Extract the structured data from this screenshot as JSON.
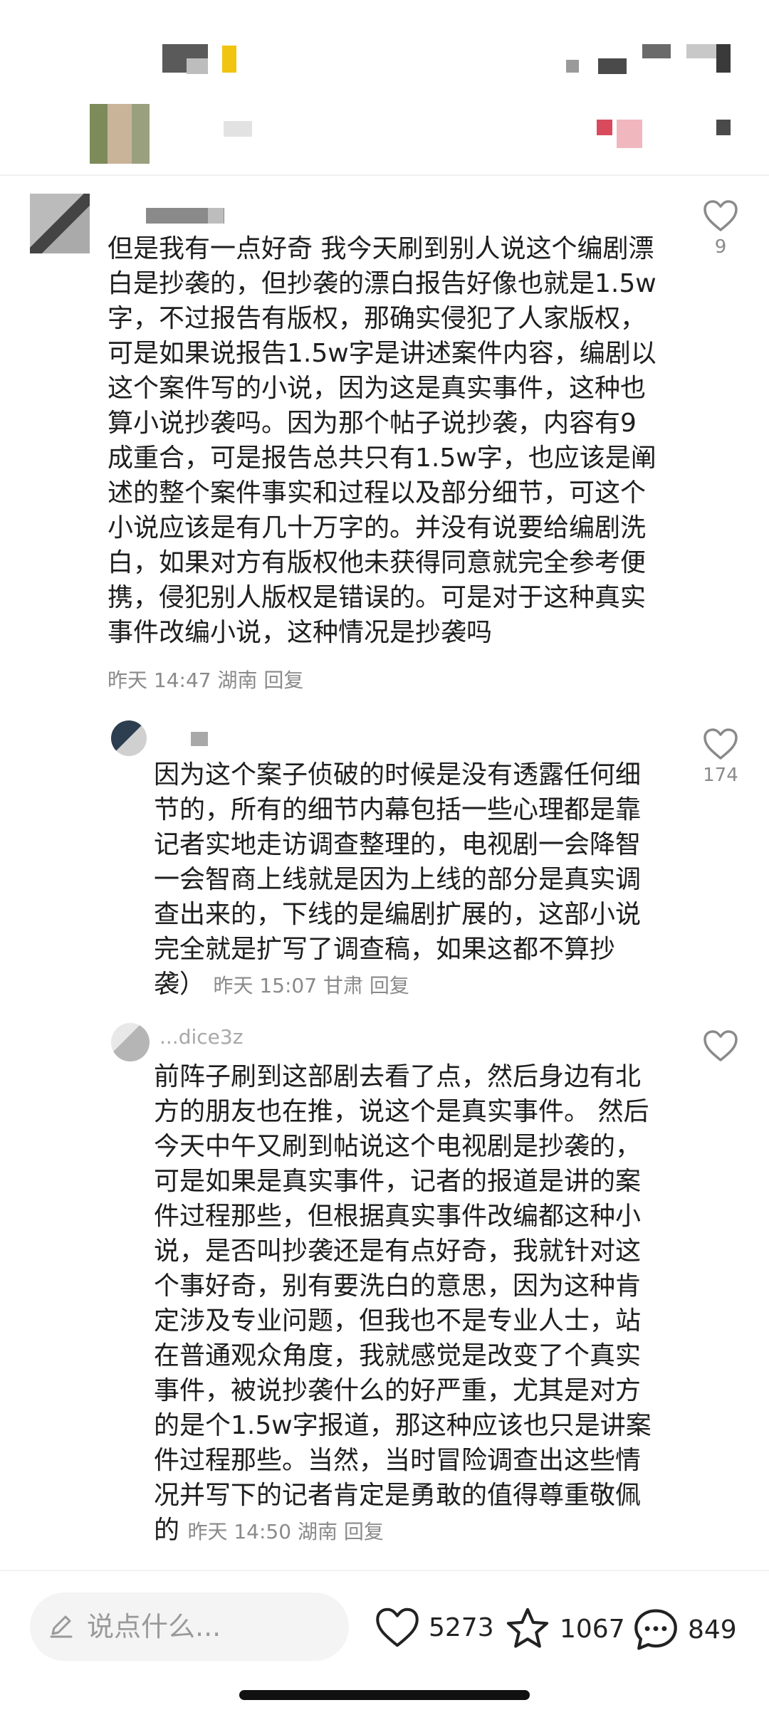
{
  "comments": [
    {
      "lines": [
        "但是我有一点好奇 我今天刷到别人说这个编剧漂",
        "白是抄袭的，但抄袭的漂白报告好像也就是1.5w",
        "字，不过报告有版权，那确实侵犯了人家版权，",
        "可是如果说报告1.5w字是讲述案件内容，编剧以",
        "这个案件写的小说，因为这是真实事件，这种也",
        "算小说抄袭吗。因为那个帖子说抄袭，内容有9",
        "成重合，可是报告总共只有1.5w字，也应该是阐",
        "述的整个案件事实和过程以及部分细节，可这个",
        "小说应该是有几十万字的。并没有说要给编剧洗",
        "白，如果对方有版权他未获得同意就完全参考便",
        "携，侵犯别人版权是错误的。可是对于这种真实",
        "事件改编小说，这种情况是抄袭吗"
      ],
      "time": "昨天 14:47",
      "location": "湖南",
      "reply": "回复",
      "likes": "9"
    },
    {
      "lines": [
        "因为这个案子侦破的时候是没有透露任何细",
        "节的，所有的细节内幕包括一些心理都是靠",
        "记者实地走访调查整理的，电视剧一会降智",
        "一会智商上线就是因为上线的部分是真实调",
        "查出来的，下线的是编剧扩展的，这部小说",
        "完全就是扩写了调查稿，如果这都不算抄"
      ],
      "last_line": "袭）",
      "time": "昨天 15:07",
      "location": "甘肃",
      "reply": "回复",
      "likes": "174"
    },
    {
      "username": "...dice3z",
      "lines": [
        "前阵子刷到这部剧去看了点，然后身边有北",
        "方的朋友也在推，说这个是真实事件。 然后",
        "今天中午又刷到帖说这个电视剧是抄袭的，",
        "可是如果是真实事件，记者的报道是讲的案",
        "件过程那些，但根据真实事件改编都这种小",
        "说，是否叫抄袭还是有点好奇，我就针对这",
        "个事好奇，别有要洗白的意思，因为这种肯",
        "定涉及专业问题，但我也不是专业人士，站",
        "在普通观众角度，我就感觉是改变了个真实",
        "事件，被说抄袭什么的好严重，尤其是对方",
        "的是个1.5w字报道，那这种应该也只是讲案",
        "件过程那些。当然，当时冒险调查出这些情",
        "况并写下的记者肯定是勇敢的值得尊重敬佩"
      ],
      "last_line": "的",
      "time": "昨天 14:50",
      "location": "湖南",
      "reply": "回复"
    }
  ],
  "bottom_bar": {
    "placeholder": "说点什么...",
    "likes": "5273",
    "stars": "1067",
    "comments": "849"
  },
  "icons": [
    "heart-icon",
    "star-icon",
    "comment-icon",
    "pen-icon"
  ]
}
